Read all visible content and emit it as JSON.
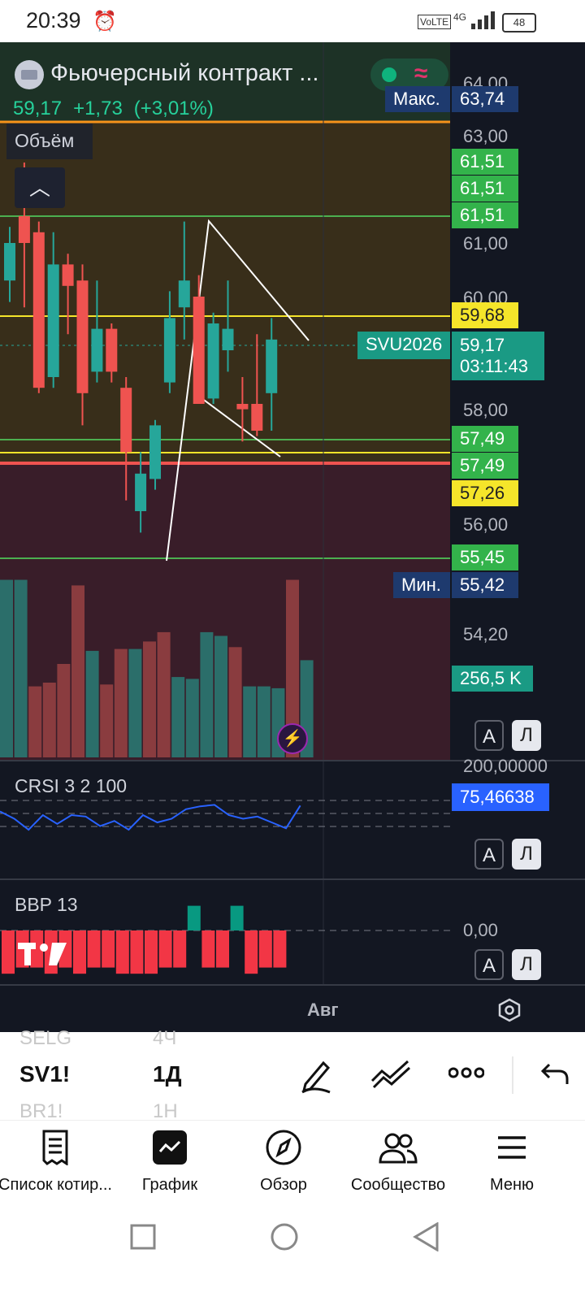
{
  "status": {
    "time": "20:39",
    "net": "VoLTE",
    "gen": "4G",
    "battery": "48"
  },
  "symbol": {
    "name": "Фьючерсный контракт ...",
    "price": "59,17",
    "change": "+1,73",
    "change_pct": "(+3,01%)",
    "volume_label": "Объём",
    "ticker_tag": "SVU2026",
    "countdown": "03:11:43",
    "current_price": "59,17"
  },
  "price_axis": {
    "ticks": [
      "64,00",
      "63,00",
      "61,00",
      "60,00",
      "58,00",
      "56,00",
      "54,20"
    ],
    "max_label": "Макс.",
    "max_value": "63,74",
    "min_label": "Мин.",
    "min_value": "55,42",
    "levels": [
      {
        "value": "61,51",
        "color": "green"
      },
      {
        "value": "61,51",
        "color": "green"
      },
      {
        "value": "61,51",
        "color": "green"
      },
      {
        "value": "59,68",
        "color": "yellow"
      },
      {
        "value": "57,49",
        "color": "green"
      },
      {
        "value": "57,49",
        "color": "green"
      },
      {
        "value": "57,26",
        "color": "yellow"
      },
      {
        "value": "55,45",
        "color": "green"
      }
    ],
    "volume_value": "256,5 K"
  },
  "indicators": {
    "crsi": {
      "label": "CRSI 3 2 100",
      "value": "75,46638",
      "axis_top": "200,00000"
    },
    "bbp": {
      "label": "BBP 13",
      "axis_zero": "0,00"
    }
  },
  "scale_buttons": {
    "auto": "А",
    "log": "Л"
  },
  "time_axis": {
    "label": "Авг"
  },
  "candles": [
    {
      "o": 60.3,
      "h": 61.3,
      "l": 59.9,
      "c": 61.0
    },
    {
      "o": 61.5,
      "h": 62.5,
      "l": 59.8,
      "c": 61.0
    },
    {
      "o": 61.2,
      "h": 61.4,
      "l": 58.2,
      "c": 58.3
    },
    {
      "o": 58.5,
      "h": 61.2,
      "l": 58.3,
      "c": 60.6
    },
    {
      "o": 60.6,
      "h": 60.8,
      "l": 59.3,
      "c": 60.2
    },
    {
      "o": 60.3,
      "h": 60.6,
      "l": 57.6,
      "c": 58.2
    },
    {
      "o": 58.6,
      "h": 60.3,
      "l": 58.4,
      "c": 59.4
    },
    {
      "o": 59.4,
      "h": 59.5,
      "l": 58.4,
      "c": 58.6
    },
    {
      "o": 58.3,
      "h": 58.5,
      "l": 56.2,
      "c": 57.1
    },
    {
      "o": 56.0,
      "h": 57.1,
      "l": 55.6,
      "c": 56.7
    },
    {
      "o": 56.6,
      "h": 57.7,
      "l": 56.4,
      "c": 57.6
    },
    {
      "o": 58.4,
      "h": 60.1,
      "l": 58.2,
      "c": 59.6
    },
    {
      "o": 59.8,
      "h": 61.4,
      "l": 59.2,
      "c": 60.3
    },
    {
      "o": 60.0,
      "h": 60.4,
      "l": 58.0,
      "c": 58.0
    },
    {
      "o": 58.1,
      "h": 59.7,
      "l": 58.0,
      "c": 59.5
    },
    {
      "o": 59.0,
      "h": 60.3,
      "l": 58.6,
      "c": 59.4
    },
    {
      "o": 58.0,
      "h": 58.5,
      "l": 57.3,
      "c": 57.9
    },
    {
      "o": 58.0,
      "h": 59.3,
      "l": 57.4,
      "c": 57.5
    },
    {
      "o": 58.2,
      "h": 59.6,
      "l": 57.5,
      "c": 59.2
    }
  ],
  "volumes": [
    {
      "v": 0.95,
      "up": true
    },
    {
      "v": 0.95,
      "up": true
    },
    {
      "v": 0.38,
      "up": false
    },
    {
      "v": 0.4,
      "up": false
    },
    {
      "v": 0.5,
      "up": false
    },
    {
      "v": 0.92,
      "up": false
    },
    {
      "v": 0.57,
      "up": true
    },
    {
      "v": 0.39,
      "up": false
    },
    {
      "v": 0.58,
      "up": false
    },
    {
      "v": 0.58,
      "up": true
    },
    {
      "v": 0.62,
      "up": false
    },
    {
      "v": 0.67,
      "up": false
    },
    {
      "v": 0.43,
      "up": true
    },
    {
      "v": 0.42,
      "up": true
    },
    {
      "v": 0.67,
      "up": true
    },
    {
      "v": 0.65,
      "up": true
    },
    {
      "v": 0.59,
      "up": false
    },
    {
      "v": 0.38,
      "up": true
    },
    {
      "v": 0.38,
      "up": true
    },
    {
      "v": 0.37,
      "up": true
    },
    {
      "v": 0.95,
      "up": false
    },
    {
      "v": 0.52,
      "up": true
    }
  ],
  "bbp": [
    -0.7,
    -0.6,
    -0.6,
    -0.7,
    -0.6,
    -0.7,
    -0.6,
    -0.6,
    -0.7,
    -0.7,
    -0.7,
    -0.6,
    -0.6,
    0.4,
    -0.6,
    -0.6,
    0.4,
    -0.7,
    -0.6,
    -0.6
  ],
  "crsi_line": [
    65,
    55,
    40,
    60,
    48,
    60,
    58,
    45,
    52,
    40,
    60,
    50,
    55,
    68,
    72,
    74,
    60,
    55,
    58,
    50,
    42,
    73
  ],
  "toolbar": {
    "ghost_top_sym": "SELG",
    "ghost_top_tf": "4Ч",
    "symbol": "SV1!",
    "timeframe": "1Д",
    "ghost_bot_sym": "BR1!",
    "ghost_bot_tf": "1Н"
  },
  "tabs": [
    "Список котир...",
    "График",
    "Обзор",
    "Сообщество",
    "Меню"
  ],
  "colors": {
    "up": "#26a69a",
    "down": "#ef5350",
    "accent_red": "#e0336b",
    "bg": "#131722"
  }
}
